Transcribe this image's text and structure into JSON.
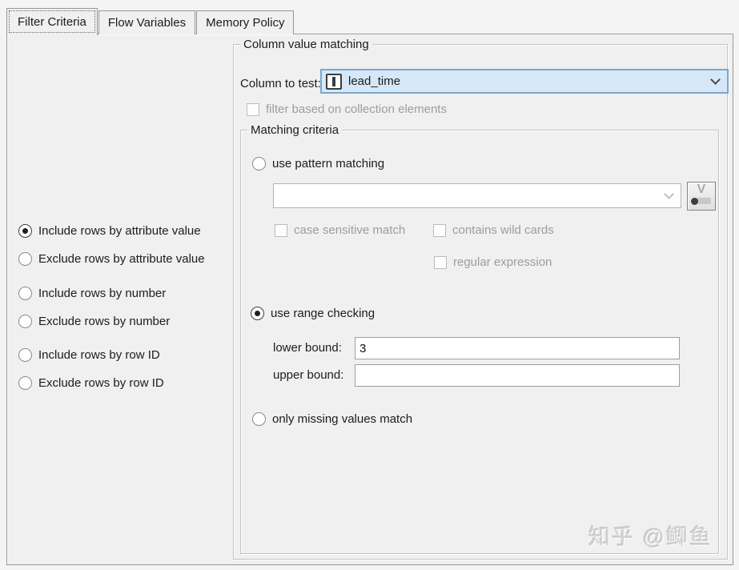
{
  "tabs": {
    "items": [
      {
        "label": "Filter Criteria",
        "active": true
      },
      {
        "label": "Flow Variables",
        "active": false
      },
      {
        "label": "Memory Policy",
        "active": false
      }
    ]
  },
  "left_panel": {
    "options": [
      {
        "label": "Include rows by attribute value",
        "selected": true
      },
      {
        "label": "Exclude rows by attribute value",
        "selected": false
      },
      {
        "label": "Include rows by number",
        "selected": false
      },
      {
        "label": "Exclude rows by number",
        "selected": false
      },
      {
        "label": "Include rows by row ID",
        "selected": false
      },
      {
        "label": "Exclude rows by row ID",
        "selected": false
      }
    ]
  },
  "column_matching": {
    "title": "Column value matching",
    "column_to_test_label": "Column to test:",
    "selected_column": {
      "name": "lead_time",
      "type_icon": "integer-column-icon",
      "type_letter": "I"
    },
    "collection_checkbox": {
      "label": "filter based on collection elements",
      "checked": false,
      "enabled": false
    },
    "matching_criteria": {
      "title": "Matching criteria",
      "pattern": {
        "radio_label": "use pattern matching",
        "selected": false,
        "combo_value": "",
        "combo_enabled": false,
        "case_sensitive": {
          "label": "case sensitive match",
          "checked": false,
          "enabled": false
        },
        "wild_cards": {
          "label": "contains wild cards",
          "checked": false,
          "enabled": false
        },
        "regex": {
          "label": "regular expression",
          "checked": false,
          "enabled": false
        }
      },
      "range": {
        "radio_label": "use range checking",
        "selected": true,
        "lower_bound": {
          "label": "lower bound:",
          "value": "3"
        },
        "upper_bound": {
          "label": "upper bound:",
          "value": ""
        }
      },
      "missing": {
        "radio_label": "only missing values match",
        "selected": false
      }
    }
  },
  "watermark": "知乎 @鲫鱼",
  "colors": {
    "panel_bg": "#f0f0f0",
    "selection_bg": "#d6e8f8",
    "selection_border": "#7ba7cc",
    "disabled_text": "#9d9d9d"
  }
}
